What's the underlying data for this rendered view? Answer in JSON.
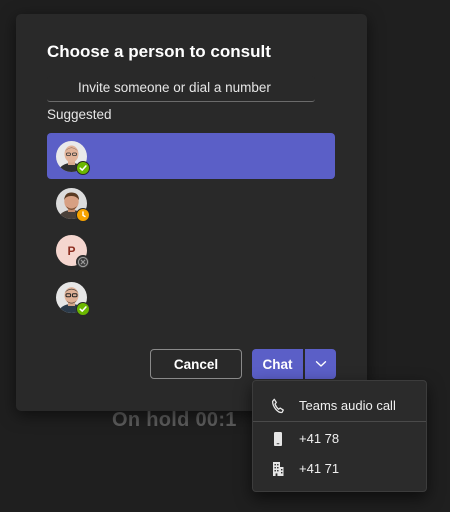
{
  "background": {
    "hold_status": "On hold 00:1"
  },
  "dialog": {
    "title": "Choose a person to consult",
    "search": {
      "placeholder": "Invite someone or dial a number"
    },
    "suggested_label": "Suggested",
    "suggested": [
      {
        "avatar": "person-avatar-photo",
        "presence": "available",
        "selected": true
      },
      {
        "avatar": "person-avatar-photo",
        "presence": "away",
        "selected": false
      },
      {
        "avatar": "initial-avatar",
        "initial": "P",
        "presence": "offline",
        "selected": false
      },
      {
        "avatar": "person-avatar-photo",
        "presence": "available",
        "selected": false
      }
    ],
    "buttons": {
      "cancel": "Cancel",
      "chat": "Chat"
    }
  },
  "call_menu": {
    "items": [
      {
        "icon": "phone-icon",
        "label": "Teams audio call"
      },
      {
        "icon": "mobile-phone-icon",
        "label": "+41 78"
      },
      {
        "icon": "office-phone-icon",
        "label": "+41 71"
      }
    ]
  },
  "colors": {
    "accent": "#5b5fc7",
    "available": "#6bb700",
    "away": "#f8a300",
    "offline": "#8a8a8a",
    "dialog_bg": "#292929",
    "page_bg": "#1f1f1f"
  }
}
